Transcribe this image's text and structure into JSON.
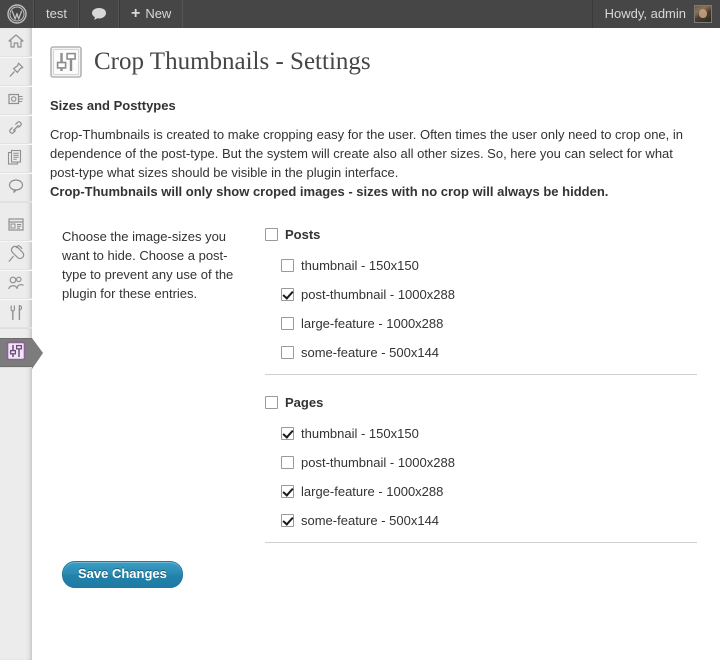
{
  "adminbar": {
    "logo_icon": "wordpress-logo-icon",
    "site_name": "test",
    "comments_icon": "comment-bubble-icon",
    "new_plus": "+",
    "new_label": "New",
    "howdy": "Howdy, admin",
    "avatar_icon": "user-avatar"
  },
  "adminmenu": {
    "items": [
      {
        "name": "dashboard",
        "icon": "home-icon"
      },
      {
        "name": "posts",
        "icon": "pin-icon"
      },
      {
        "name": "media",
        "icon": "camera-icon"
      },
      {
        "name": "links",
        "icon": "chain-link-icon"
      },
      {
        "name": "pages",
        "icon": "pages-icon"
      },
      {
        "name": "comments",
        "icon": "comment-bubble-icon"
      },
      {
        "name": "appearance",
        "icon": "appearance-window-icon"
      },
      {
        "name": "plugins",
        "icon": "plug-icon"
      },
      {
        "name": "users",
        "icon": "users-icon"
      },
      {
        "name": "tools",
        "icon": "tools-icon"
      },
      {
        "name": "crop-thumbnails",
        "icon": "sliders-icon",
        "current": true
      }
    ]
  },
  "page": {
    "title": "Crop Thumbnails - Settings",
    "title_icon": "sliders-icon",
    "section_title": "Sizes and Posttypes",
    "intro_paragraph": "Crop-Thumbnails is created to make cropping easy for the user. Often times the user only need to crop one, in dependence of the post-type. But the system will create also all other sizes. So, here you can select for what post-type what sizes should be visible in the plugin interface.",
    "intro_bold": "Crop-Thumbnails will only show croped images - sizes with no crop will always be hidden.",
    "help_text": "Choose the image-sizes you want to hide. Choose a post-type to prevent any use of the plugin for these entries."
  },
  "groups": [
    {
      "label": "Posts",
      "checked": false,
      "sizes": [
        {
          "label": "thumbnail - 150x150",
          "checked": false
        },
        {
          "label": "post-thumbnail - 1000x288",
          "checked": true
        },
        {
          "label": "large-feature - 1000x288",
          "checked": false
        },
        {
          "label": "some-feature - 500x144",
          "checked": false
        }
      ]
    },
    {
      "label": "Pages",
      "checked": false,
      "sizes": [
        {
          "label": "thumbnail - 150x150",
          "checked": true
        },
        {
          "label": "post-thumbnail - 1000x288",
          "checked": false
        },
        {
          "label": "large-feature - 1000x288",
          "checked": true
        },
        {
          "label": "some-feature - 500x144",
          "checked": true
        }
      ]
    }
  ],
  "submit": {
    "save_label": "Save Changes"
  },
  "colors": {
    "adminbar_bg": "#464646",
    "menu_bg": "#ececec",
    "menu_current_bg": "#7c7c7c",
    "button_primary": "#2183ac",
    "text": "#333333",
    "title": "#464646"
  }
}
